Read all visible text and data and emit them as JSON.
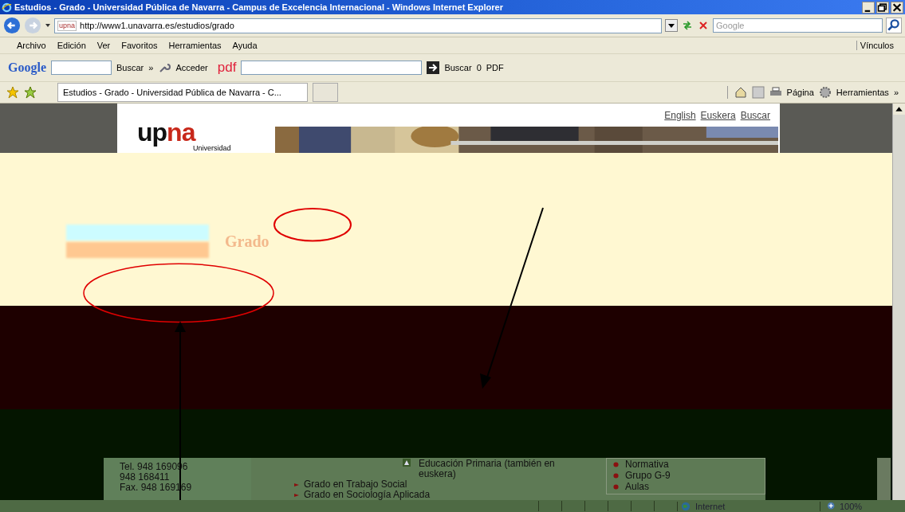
{
  "window": {
    "title": "Estudios - Grado - Universidad Pública de Navarra - Campus de Excelencia Internacional - Windows Internet Explorer"
  },
  "address_bar": {
    "favicon": "upna",
    "url": "http://www1.unavarra.es/estudios/grado",
    "search_placeholder": "Google"
  },
  "menu": [
    "Archivo",
    "Edición",
    "Ver",
    "Favoritos",
    "Herramientas",
    "Ayuda"
  ],
  "links_label": "Vínculos",
  "google_toolbar": {
    "logo": "Google",
    "search_label": "Buscar",
    "more": "»",
    "sign_in": "Acceder",
    "pdf_logo": "pdf",
    "pdf_search": "Buscar",
    "count": "0",
    "pdf_label": "PDF"
  },
  "tab": {
    "label": "Estudios - Grado - Universidad Pública de Navarra - C...",
    "selected": true
  },
  "command_bar": {
    "page": "Página",
    "tools": "Herramientas",
    "more": "»"
  },
  "page": {
    "header_links": [
      "English",
      "Euskera",
      "Buscar"
    ],
    "logo": {
      "up": "up",
      "na": "na",
      "sub": "Universidad"
    },
    "heading": "Grado",
    "contact": [
      "Tel. 948 169096",
      "948 168411",
      "Fax. 948 169169"
    ],
    "degrees": [
      {
        "label": "Educación Primaria (también en euskera)",
        "kind": "icon"
      },
      {
        "label": "Grado en Trabajo Social",
        "kind": "bullet"
      },
      {
        "label": "Grado en Sociología Aplicada",
        "kind": "bullet"
      }
    ],
    "side_links": [
      "Normativa",
      "Grupo G-9",
      "Aulas"
    ]
  },
  "status_bar": {
    "zone": "Internet",
    "zoom": "100%"
  }
}
